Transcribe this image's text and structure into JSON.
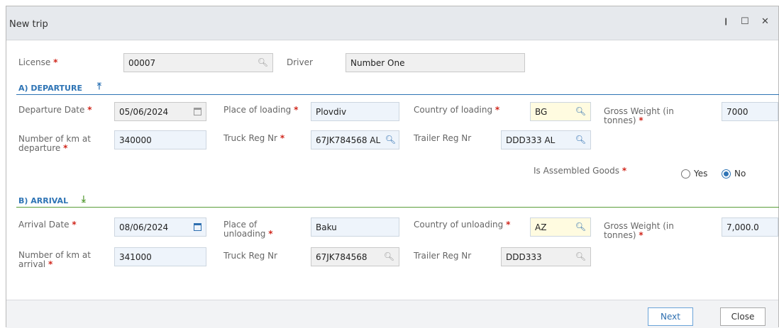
{
  "window": {
    "title": "New trip",
    "pin_icon": "pin-icon",
    "maximize_icon": "maximize-icon",
    "close_icon": "close-icon"
  },
  "license": {
    "label": "License",
    "value": "00007"
  },
  "driver": {
    "label": "Driver",
    "value": "Number One"
  },
  "departure": {
    "header": "A) DEPARTURE",
    "icon": "upload-icon",
    "date_label": "Departure Date",
    "date_value": "05/06/2024",
    "place_label": "Place of loading",
    "place_value": "Plovdiv",
    "country_label": "Country of loading",
    "country_value": "BG",
    "gross_label_1": "Gross Weight (in",
    "gross_label_2": "tonnes)",
    "gross_value": "7000",
    "km_label_1": "Number of km at",
    "km_label_2": "departure",
    "km_value": "340000",
    "truck_label": "Truck Reg Nr",
    "truck_value": "67JK784568 AL",
    "trailer_label": "Trailer Reg Nr",
    "trailer_value": "DDD333 AL",
    "assembled_label": "Is Assembled Goods",
    "yes_label": "Yes",
    "no_label": "No",
    "assembled_selected": "No"
  },
  "arrival": {
    "header": "B) ARRIVAL",
    "icon": "download-icon",
    "date_label": "Arrival Date",
    "date_value": "08/06/2024",
    "place_label_1": "Place of",
    "place_label_2": "unloading",
    "place_value": "Baku",
    "country_label": "Country of unloading",
    "country_value": "AZ",
    "gross_label_1": "Gross Weight (in",
    "gross_label_2": "tonnes)",
    "gross_value": "7,000.0",
    "km_label_1": "Number of km at",
    "km_label_2": "arrival",
    "km_value": "341000",
    "truck_label": "Truck Reg Nr",
    "truck_value": "67JK784568",
    "trailer_label": "Trailer Reg Nr",
    "trailer_value": "DDD333"
  },
  "footer": {
    "next_label": "Next",
    "close_label": "Close"
  },
  "colors": {
    "accent": "#2e74b5",
    "departure_rule": "#2e74b5",
    "arrival_rule": "#5a9e3a",
    "required": "#d0261b"
  }
}
